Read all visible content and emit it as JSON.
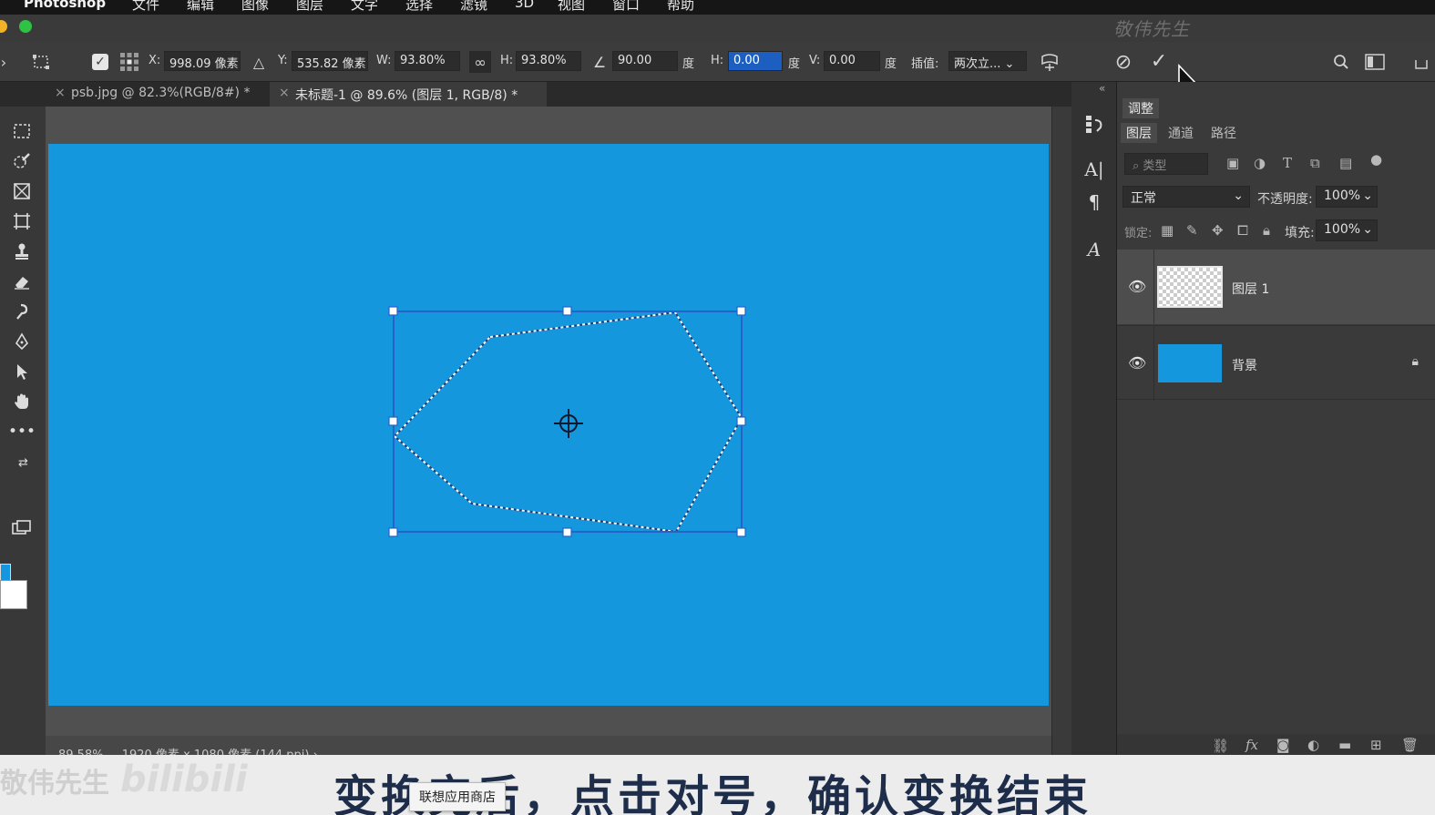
{
  "menubar": {
    "app": "Photoshop",
    "items": [
      "文件",
      "编辑",
      "图像",
      "图层",
      "文字",
      "选择",
      "滤镜",
      "3D",
      "视图",
      "窗口",
      "帮助"
    ]
  },
  "watermark_top": "敬伟先生",
  "options": {
    "x_label": "X:",
    "x_value": "998.09 像素",
    "y_label": "Y:",
    "y_value": "535.82 像素",
    "w_label": "W:",
    "w_value": "93.80%",
    "h_label": "H:",
    "h_value": "93.80%",
    "angle_value": "90.00",
    "angle_unit": "度",
    "skew_h_label": "H:",
    "skew_h_value": "0.00",
    "skew_h_unit": "度",
    "skew_v_label": "V:",
    "skew_v_value": "0.00",
    "skew_v_unit": "度",
    "interp_label": "插值:",
    "interp_value": "两次立..."
  },
  "tabs": [
    {
      "label": "psb.jpg @ 82.3%(RGB/8#) *",
      "active": false
    },
    {
      "label": "未标题-1 @ 89.6% (图层 1, RGB/8) *",
      "active": true
    }
  ],
  "status": {
    "zoom": "89.58%",
    "doc_info": "1920 像素 x 1080 像素 (144 ppi)"
  },
  "panel": {
    "top_tab": "调整",
    "tabs": [
      "图层",
      "通道",
      "路径"
    ],
    "filter_placeholder": "类型",
    "blend_mode": "正常",
    "opacity_label": "不透明度:",
    "opacity_value": "100%",
    "lock_label": "锁定:",
    "fill_label": "填充:",
    "fill_value": "100%",
    "layers": [
      {
        "name": "图层 1",
        "selected": true
      },
      {
        "name": "背景",
        "selected": false,
        "locked": true
      }
    ]
  },
  "subtitle": {
    "text": "变换完后，点击对号，确认变换结束",
    "watermark": "敬伟先生",
    "bili": "bilibili"
  },
  "tooltip": "联想应用商店",
  "colors": {
    "canvas": "#1597dd",
    "transform_box": "#2563c9",
    "selection_edge": "#ffffff"
  }
}
